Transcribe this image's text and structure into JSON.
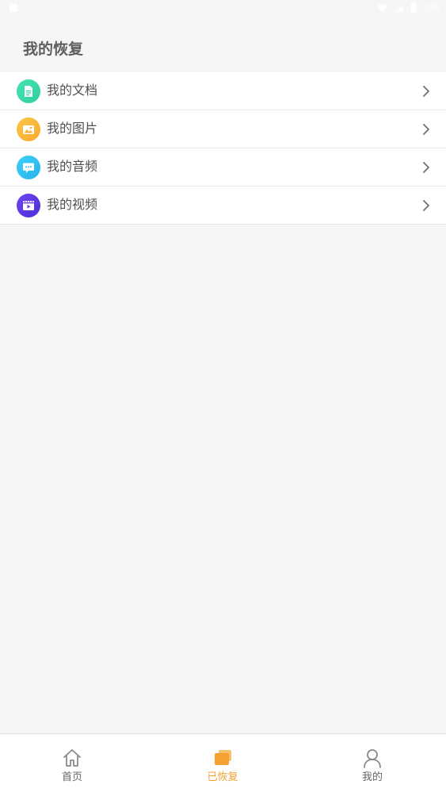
{
  "page": {
    "title": "我的恢复"
  },
  "status_bar": {
    "time": "2:48"
  },
  "list": {
    "items": [
      {
        "label": "我的文档",
        "icon": "document-icon",
        "color": "#3ed9a9"
      },
      {
        "label": "我的图片",
        "icon": "image-icon",
        "color": "#fbb83a"
      },
      {
        "label": "我的音频",
        "icon": "message-icon",
        "color": "#32c3f2"
      },
      {
        "label": "我的视频",
        "icon": "video-icon",
        "color": "#5b3ae6"
      }
    ]
  },
  "tabbar": {
    "tabs": [
      {
        "label": "首页",
        "icon": "home-icon",
        "active": false
      },
      {
        "label": "已恢复",
        "icon": "recovered-icon",
        "active": true
      },
      {
        "label": "我的",
        "icon": "user-icon",
        "active": false
      }
    ]
  },
  "colors": {
    "accent": "#f5a132",
    "background": "#f6f6f6"
  }
}
